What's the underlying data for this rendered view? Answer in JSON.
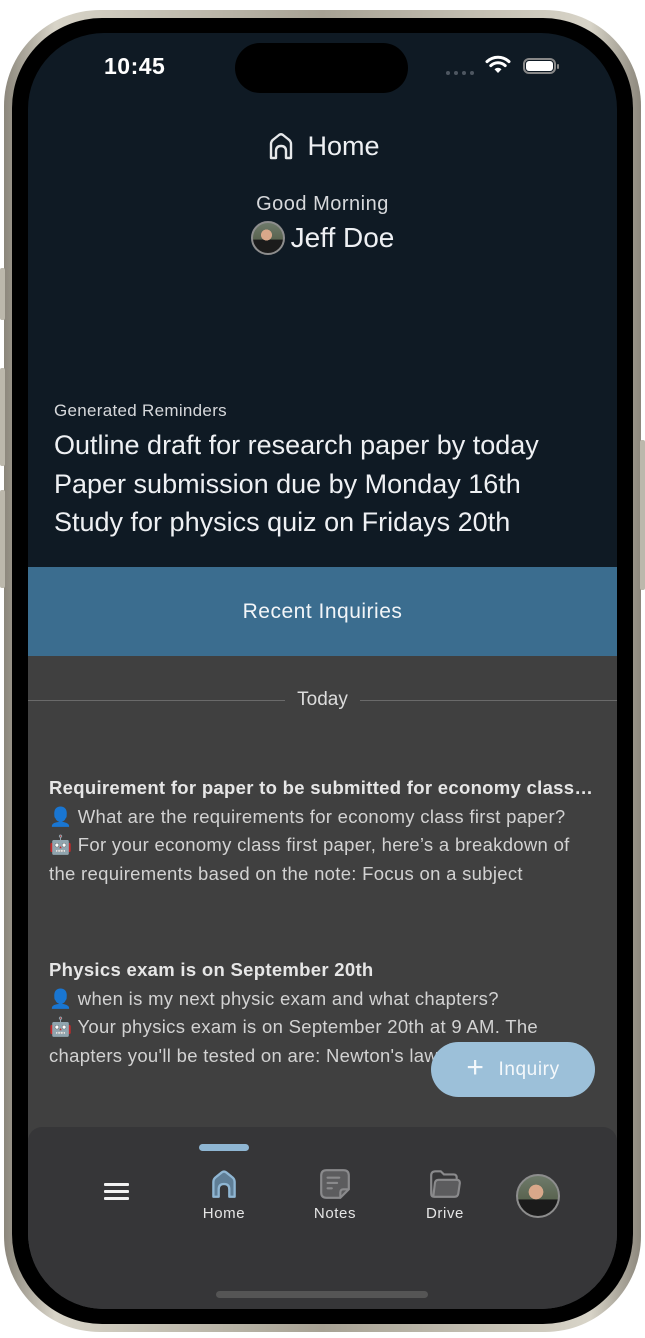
{
  "status_bar": {
    "time": "10:45"
  },
  "header": {
    "title": "Home",
    "icon": "home-icon"
  },
  "greeting": {
    "text": "Good Morning",
    "user_name": "Jeff Doe"
  },
  "reminders": {
    "label": "Generated Reminders",
    "items": [
      "Outline draft for research paper by today",
      "Paper submission due by Monday 16th",
      "Study for physics quiz on Fridays 20th"
    ]
  },
  "recent_inquiries": {
    "title": "Recent Inquiries",
    "section_label": "Today",
    "items": [
      {
        "title": "Requirement for paper to be submitted for economy class first paper",
        "question_icon": "👤",
        "question": "What are the requirements for economy class first paper?",
        "answer_icon": "🤖",
        "answer": "For your economy class first paper, here’s a breakdown of the requirements based on the note: Focus on a subject"
      },
      {
        "title": "Physics exam is on September 20th",
        "question_icon": "👤",
        "question": "when is my next physic exam and what chapters?",
        "answer_icon": "🤖",
        "answer": "Your physics exam is on September 20th at 9 AM. The chapters you'll be tested on are: Newton's laws"
      }
    ]
  },
  "fab": {
    "label": "Inquiry",
    "icon": "plus-icon"
  },
  "tab_bar": {
    "items": [
      {
        "label": "Home",
        "icon": "home-icon",
        "active": true
      },
      {
        "label": "Notes",
        "icon": "notes-icon",
        "active": false
      },
      {
        "label": "Drive",
        "icon": "folder-icon",
        "active": false
      }
    ]
  },
  "colors": {
    "header_bg": "#0f1a24",
    "accent_band": "#3b6d8f",
    "list_bg": "#404040",
    "fab_bg": "#9cc0d9",
    "tab_active": "#8fb6d3"
  }
}
